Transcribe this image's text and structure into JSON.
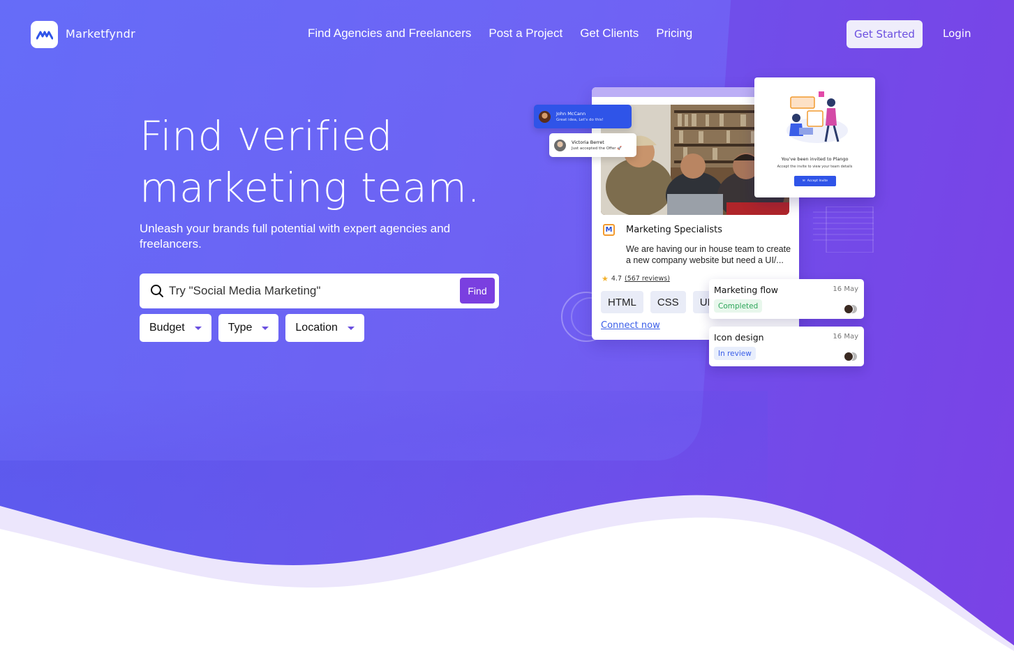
{
  "brand": {
    "name": "Marketfyndr"
  },
  "nav": {
    "links": [
      "Find Agencies and Freelancers",
      "Post a Project",
      "Get Clients",
      "Pricing"
    ],
    "get_started": "Get Started",
    "login": "Login"
  },
  "hero": {
    "headline_line1": "Find verified",
    "headline_line2": "marketing team.",
    "subhead": "Unleash your brands full potential with expert agencies and freelancers."
  },
  "search": {
    "placeholder": "Try \"Social Media Marketing\"",
    "find_label": "Find"
  },
  "filters": [
    "Budget",
    "Type",
    "Location"
  ],
  "illustration": {
    "chat1": {
      "name": "John McCann",
      "message": "Great idea, Let's do this!"
    },
    "chat2": {
      "name": "Victoria Berret",
      "message": "Just accepted the Offer 🚀"
    },
    "invite": {
      "title": "You've been invited to Plango",
      "subtitle": "Accept the invite to view your team details",
      "button": "Accept Invite"
    },
    "card": {
      "icon_letter": "M",
      "title": "Marketing Specialists",
      "description": "We are having our in house team to create a new company website but need a UI/...",
      "rating": "4.7",
      "reviews": "(567 reviews)",
      "tags": [
        "HTML",
        "CSS",
        "UI"
      ],
      "connect": "Connect now"
    },
    "tasks": [
      {
        "title": "Marketing flow",
        "date": "16 May",
        "status": "Completed"
      },
      {
        "title": "Icon design",
        "date": "16 May",
        "status": "In review"
      }
    ]
  },
  "colors": {
    "accent": "#7a3fe0",
    "link_blue": "#3a5ee8",
    "hero_start": "#5b5ff0",
    "hero_end": "#7a42e6"
  }
}
